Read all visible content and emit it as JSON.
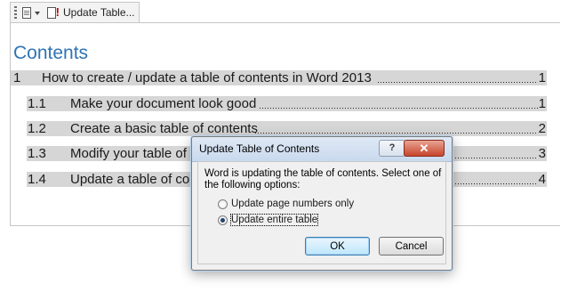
{
  "content_control": {
    "label": "Update Table..."
  },
  "toc": {
    "title": "Contents",
    "entries": [
      {
        "num": "1",
        "text": "How to create / update a table of contents in Word 2013",
        "page": "1"
      },
      {
        "num": "1.1",
        "text": "Make your document look good",
        "page": "1"
      },
      {
        "num": "1.2",
        "text": "Create a basic table of contents",
        "page": "2"
      },
      {
        "num": "1.3",
        "text": "Modify your table of co",
        "page": "3"
      },
      {
        "num": "1.4",
        "text": "Update a table of co",
        "page": "4"
      }
    ]
  },
  "dialog": {
    "title": "Update Table of Contents",
    "help_label": "?",
    "close_label": "✕",
    "message": "Word is updating the table of contents.  Select one of the following options:",
    "options": [
      {
        "label": "Update page numbers only",
        "checked": false
      },
      {
        "label": "Update entire table",
        "checked": true
      }
    ],
    "ok_label": "OK",
    "cancel_label": "Cancel"
  }
}
